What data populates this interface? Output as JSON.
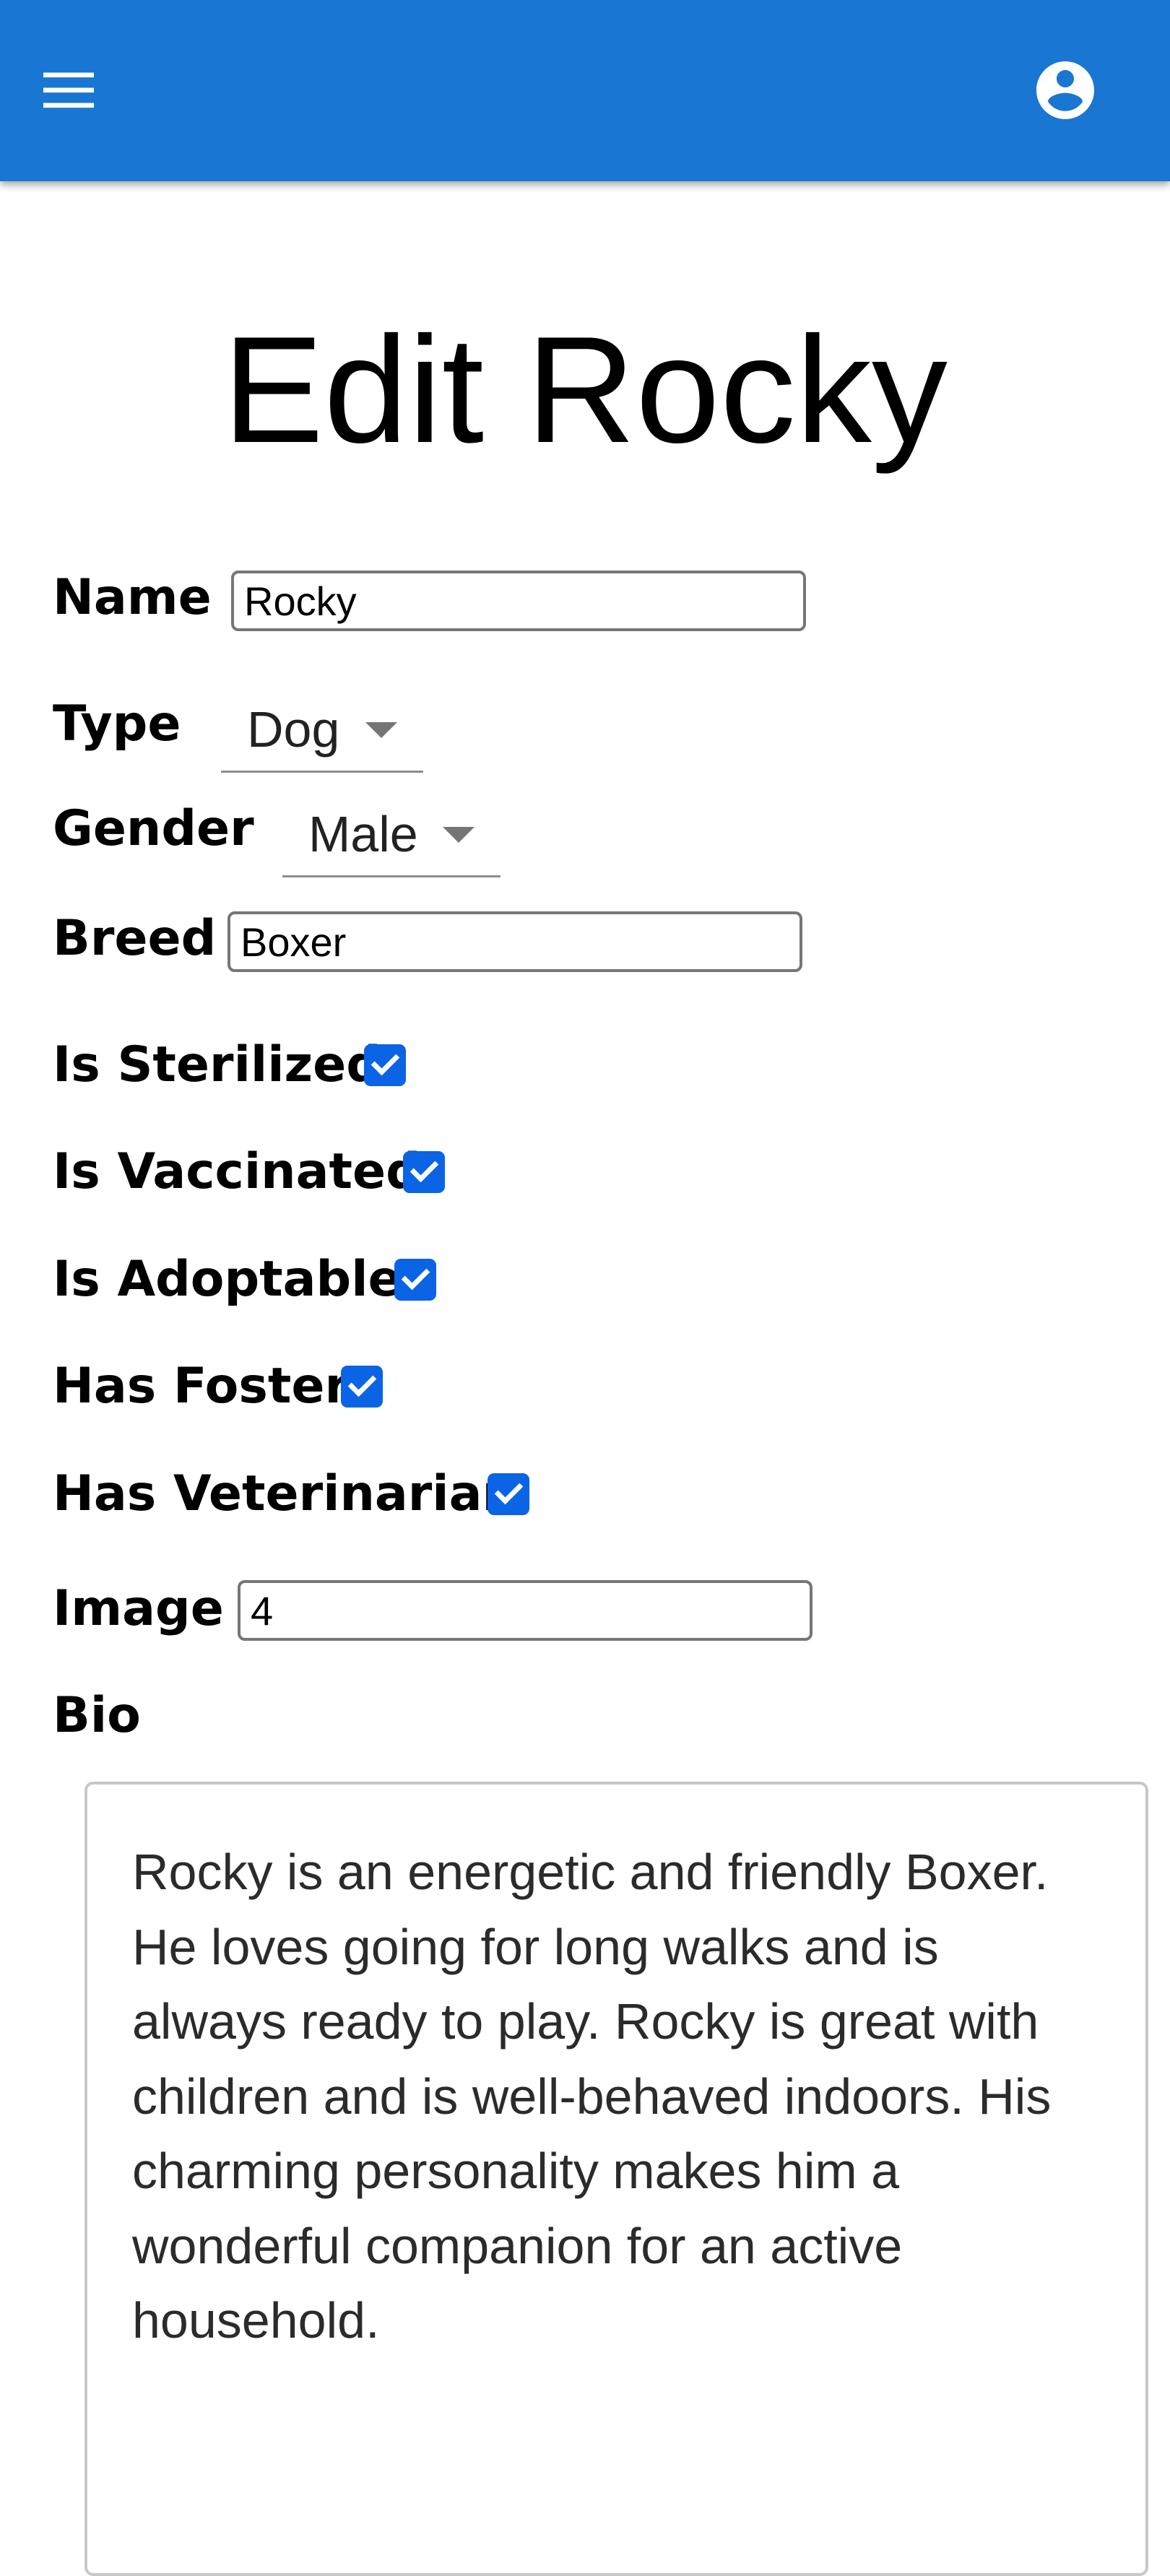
{
  "header": {
    "color": "#1976d2",
    "menu_icon": "hamburger-menu-icon",
    "account_icon": "account-circle-icon"
  },
  "page": {
    "title": "Edit Rocky"
  },
  "form": {
    "name": {
      "label": "Name",
      "value": "Rocky"
    },
    "type": {
      "label": "Type",
      "value": "Dog"
    },
    "gender": {
      "label": "Gender",
      "value": "Male"
    },
    "breed": {
      "label": "Breed",
      "value": "Boxer"
    },
    "is_sterilized": {
      "label": "Is Sterilized",
      "checked": true
    },
    "is_vaccinated": {
      "label": "Is Vaccinated",
      "checked": true
    },
    "is_adoptable": {
      "label": "Is Adoptable",
      "checked": true
    },
    "has_foster": {
      "label": "Has Foster",
      "checked": true
    },
    "has_veterinarian": {
      "label": "Has Veterinarian",
      "checked": true
    },
    "image": {
      "label": "Image",
      "value": "4"
    },
    "bio": {
      "label": "Bio",
      "value": "Rocky is an energetic and friendly Boxer. He loves going for long walks and is always ready to play. Rocky is great with children and is well-behaved indoors. His charming personality makes him a wonderful companion for an active household."
    }
  },
  "colors": {
    "checkbox": "#0b63e5"
  }
}
